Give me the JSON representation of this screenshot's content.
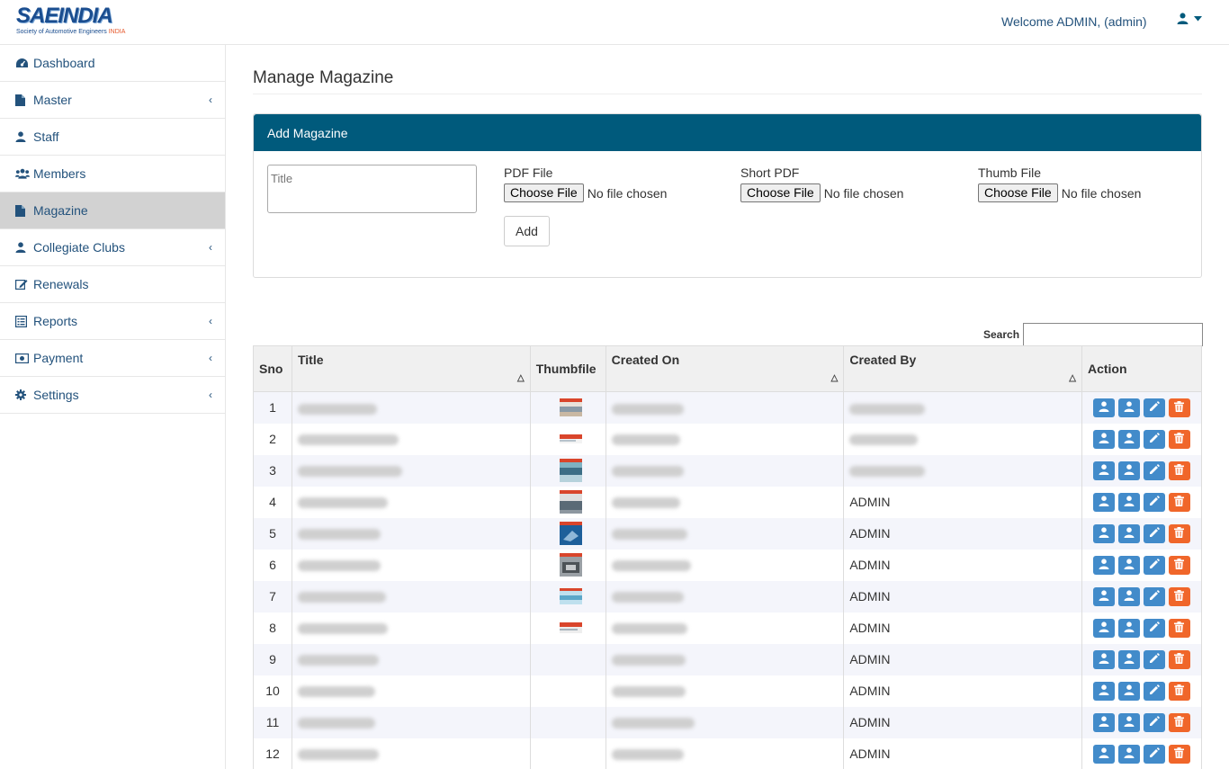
{
  "brand": {
    "logo_text": "SAEINDIA",
    "logo_sub_main": "Society of Automotive Engineers ",
    "logo_sub_accent": "INDIA"
  },
  "header": {
    "welcome": "Welcome ADMIN, (admin)",
    "user_icon": "user-icon",
    "dropdown_icon": "caret-down-icon"
  },
  "sidebar": {
    "items": [
      {
        "label": "Dashboard",
        "icon": "dashboard-icon",
        "has_submenu": false,
        "active": false
      },
      {
        "label": "Master",
        "icon": "file-icon",
        "has_submenu": true,
        "active": false
      },
      {
        "label": "Staff",
        "icon": "user-icon",
        "has_submenu": false,
        "active": false
      },
      {
        "label": "Members",
        "icon": "users-icon",
        "has_submenu": false,
        "active": false
      },
      {
        "label": "Magazine",
        "icon": "file-icon",
        "has_submenu": false,
        "active": true
      },
      {
        "label": "Collegiate Clubs",
        "icon": "user-icon",
        "has_submenu": true,
        "active": false
      },
      {
        "label": "Renewals",
        "icon": "edit-icon",
        "has_submenu": false,
        "active": false
      },
      {
        "label": "Reports",
        "icon": "list-icon",
        "has_submenu": true,
        "active": false
      },
      {
        "label": "Payment",
        "icon": "money-icon",
        "has_submenu": true,
        "active": false
      },
      {
        "label": "Settings",
        "icon": "gear-icon",
        "has_submenu": true,
        "active": false
      }
    ],
    "chevron": "‹"
  },
  "page": {
    "title": "Manage Magazine"
  },
  "add_panel": {
    "heading": "Add Magazine",
    "title_placeholder": "Title",
    "pdf_label": "PDF File",
    "short_pdf_label": "Short PDF",
    "thumb_label": "Thumb File",
    "choose_file": "Choose File",
    "no_file": "No file chosen",
    "add_button": "Add"
  },
  "table": {
    "search_label": "Search",
    "columns": [
      "Sno",
      "Title",
      "Thumbfile",
      "Created On",
      "Created By",
      "Action"
    ],
    "rows": [
      {
        "sno": "1",
        "created_by": "",
        "title_blur": 88,
        "date_blur": 80,
        "by_blur": 84,
        "thumb": "a"
      },
      {
        "sno": "2",
        "created_by": "",
        "title_blur": 112,
        "date_blur": 76,
        "by_blur": 76,
        "thumb": "b"
      },
      {
        "sno": "3",
        "created_by": "",
        "title_blur": 116,
        "date_blur": 80,
        "by_blur": 84,
        "thumb": "c"
      },
      {
        "sno": "4",
        "created_by": "ADMIN",
        "title_blur": 100,
        "date_blur": 76,
        "by_blur": 0,
        "thumb": "d"
      },
      {
        "sno": "5",
        "created_by": "ADMIN",
        "title_blur": 92,
        "date_blur": 84,
        "by_blur": 0,
        "thumb": "e"
      },
      {
        "sno": "6",
        "created_by": "ADMIN",
        "title_blur": 92,
        "date_blur": 88,
        "by_blur": 0,
        "thumb": "f"
      },
      {
        "sno": "7",
        "created_by": "ADMIN",
        "title_blur": 98,
        "date_blur": 80,
        "by_blur": 0,
        "thumb": "g"
      },
      {
        "sno": "8",
        "created_by": "ADMIN",
        "title_blur": 100,
        "date_blur": 84,
        "by_blur": 0,
        "thumb": "h"
      },
      {
        "sno": "9",
        "created_by": "ADMIN",
        "title_blur": 90,
        "date_blur": 82,
        "by_blur": 0,
        "thumb": ""
      },
      {
        "sno": "10",
        "created_by": "ADMIN",
        "title_blur": 86,
        "date_blur": 82,
        "by_blur": 0,
        "thumb": ""
      },
      {
        "sno": "11",
        "created_by": "ADMIN",
        "title_blur": 86,
        "date_blur": 92,
        "by_blur": 0,
        "thumb": ""
      },
      {
        "sno": "12",
        "created_by": "ADMIN",
        "title_blur": 90,
        "date_blur": 80,
        "by_blur": 0,
        "thumb": ""
      }
    ],
    "action_icons": [
      "user-icon",
      "user-icon",
      "pencil-icon",
      "trash-icon"
    ]
  },
  "colors": {
    "primary": "#005a7c",
    "link": "#23527c",
    "action_blue": "#428bca",
    "action_orange": "#f0662a",
    "active_nav": "#d2d2d2"
  }
}
